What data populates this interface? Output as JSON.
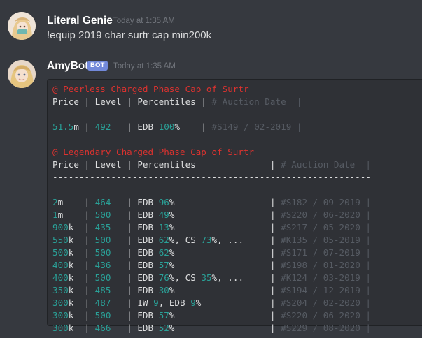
{
  "messages": [
    {
      "author": "Literal Genie",
      "timestamp": "Today at 1:35 AM",
      "content": "!equip 2019 char surtr cap min200k"
    },
    {
      "author": "AmyBot",
      "badge": "BOT",
      "timestamp": "Today at 1:35 AM"
    }
  ],
  "codeblock": {
    "peerless": {
      "title": "@ Peerless Charged Phase Cap of Surtr",
      "header": {
        "price": "Price",
        "level": "Level",
        "percentiles": "Percentiles",
        "auction": "# Auction Date"
      },
      "rule": "----------------------------------------------------",
      "rows": [
        {
          "price": "51.5",
          "suffix": "m",
          "level": "492",
          "pct": [
            [
              "EDB ",
              false
            ],
            [
              "100",
              true
            ],
            [
              "%",
              false
            ]
          ],
          "auction": "#S149 / 02-2019"
        }
      ]
    },
    "legendary": {
      "title": "@ Legendary Charged Phase Cap of Surtr",
      "header": {
        "price": "Price",
        "level": "Level",
        "percentiles": "Percentiles",
        "auction": "# Auction Date"
      },
      "rule": "------------------------------------------------------------",
      "rows": [
        {
          "price": "2",
          "suffix": "m",
          "level": "464",
          "pct": [
            [
              "EDB ",
              false
            ],
            [
              "96",
              true
            ],
            [
              "%",
              false
            ]
          ],
          "auction": "#S182 / 09-2019"
        },
        {
          "price": "1",
          "suffix": "m",
          "level": "500",
          "pct": [
            [
              "EDB ",
              false
            ],
            [
              "49",
              true
            ],
            [
              "%",
              false
            ]
          ],
          "auction": "#S220 / 06-2020"
        },
        {
          "price": "900",
          "suffix": "k",
          "level": "435",
          "pct": [
            [
              "EDB ",
              false
            ],
            [
              "13",
              true
            ],
            [
              "%",
              false
            ]
          ],
          "auction": "#S217 / 05-2020"
        },
        {
          "price": "550",
          "suffix": "k",
          "level": "500",
          "pct": [
            [
              "EDB ",
              false
            ],
            [
              "62",
              true
            ],
            [
              "%, CS ",
              false
            ],
            [
              "73",
              true
            ],
            [
              "%, ...",
              false
            ]
          ],
          "auction": "#K135 / 05-2019"
        },
        {
          "price": "500",
          "suffix": "k",
          "level": "500",
          "pct": [
            [
              "EDB ",
              false
            ],
            [
              "62",
              true
            ],
            [
              "%",
              false
            ]
          ],
          "auction": "#S171 / 07-2019"
        },
        {
          "price": "400",
          "suffix": "k",
          "level": "436",
          "pct": [
            [
              "EDB ",
              false
            ],
            [
              "57",
              true
            ],
            [
              "%",
              false
            ]
          ],
          "auction": "#S198 / 01-2020"
        },
        {
          "price": "400",
          "suffix": "k",
          "level": "500",
          "pct": [
            [
              "EDB ",
              false
            ],
            [
              "76",
              true
            ],
            [
              "%, CS ",
              false
            ],
            [
              "35",
              true
            ],
            [
              "%, ...",
              false
            ]
          ],
          "auction": "#K124 / 03-2019"
        },
        {
          "price": "350",
          "suffix": "k",
          "level": "485",
          "pct": [
            [
              "EDB ",
              false
            ],
            [
              "30",
              true
            ],
            [
              "%",
              false
            ]
          ],
          "auction": "#S194 / 12-2019"
        },
        {
          "price": "300",
          "suffix": "k",
          "level": "487",
          "pct": [
            [
              "IW ",
              false
            ],
            [
              "9",
              true
            ],
            [
              ", EDB ",
              false
            ],
            [
              "9",
              true
            ],
            [
              "%",
              false
            ]
          ],
          "auction": "#S204 / 02-2020"
        },
        {
          "price": "300",
          "suffix": "k",
          "level": "500",
          "pct": [
            [
              "EDB ",
              false
            ],
            [
              "57",
              true
            ],
            [
              "%",
              false
            ]
          ],
          "auction": "#S220 / 06-2020"
        },
        {
          "price": "300",
          "suffix": "k",
          "level": "466",
          "pct": [
            [
              "EDB ",
              false
            ],
            [
              "52",
              true
            ],
            [
              "%",
              false
            ]
          ],
          "auction": "#S229 / 08-2020"
        }
      ]
    }
  },
  "colors": {
    "background": "#36393f",
    "codeblock": "#2f3136",
    "title_red": "#dc322f",
    "number_teal": "#2aa198",
    "comment_grey": "#565b63",
    "bot_badge": "#7289da"
  }
}
